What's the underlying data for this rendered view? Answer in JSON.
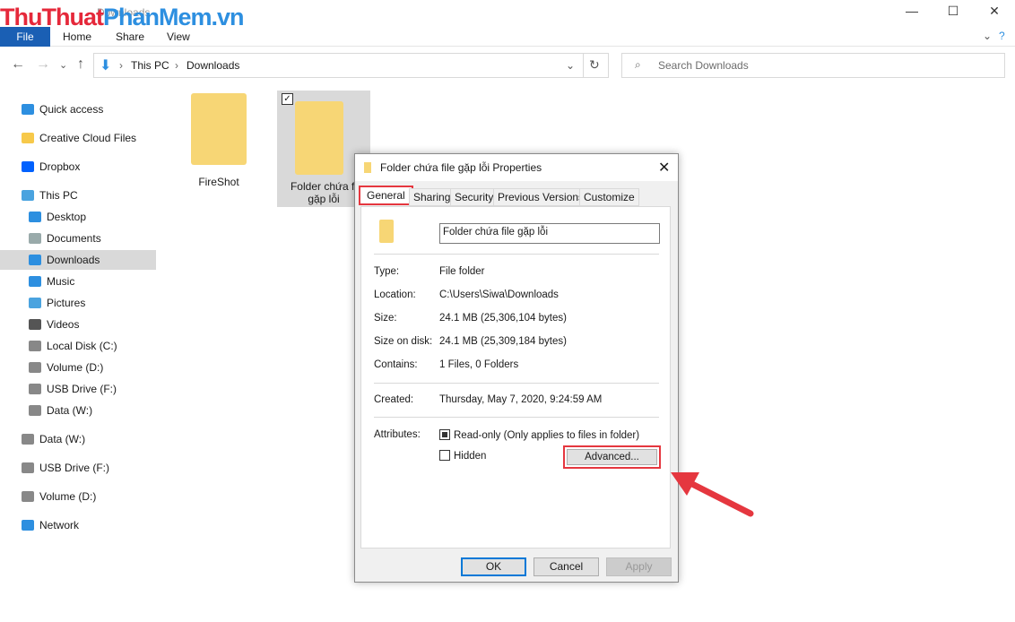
{
  "window": {
    "title": "Downloads",
    "logo": "ThuThuatPhanMem.vn",
    "logo_a": "ThuThuat",
    "logo_b": "PhanMem.vn"
  },
  "ribbon": {
    "tabs": [
      "File",
      "Home",
      "Share",
      "View"
    ]
  },
  "address": {
    "path": [
      "This PC",
      "Downloads"
    ]
  },
  "search": {
    "placeholder": "Search Downloads"
  },
  "sidebar": {
    "items": [
      {
        "label": "Quick access",
        "icon": "star-icon",
        "color": "#2d8fe0"
      },
      {
        "label": "Creative Cloud Files",
        "icon": "creative-cloud-icon",
        "color": "#f7c94a"
      },
      {
        "label": "Dropbox",
        "icon": "dropbox-icon",
        "color": "#0061fe"
      },
      {
        "label": "This PC",
        "icon": "computer-icon",
        "color": "#4aa3df"
      },
      {
        "label": "Desktop",
        "icon": "desktop-icon",
        "color": "#2d8fe0"
      },
      {
        "label": "Documents",
        "icon": "documents-icon",
        "color": "#9aa"
      },
      {
        "label": "Downloads",
        "icon": "downloads-icon",
        "color": "#2d8fe0",
        "selected": true
      },
      {
        "label": "Music",
        "icon": "music-icon",
        "color": "#2d8fe0"
      },
      {
        "label": "Pictures",
        "icon": "pictures-icon",
        "color": "#4aa3df"
      },
      {
        "label": "Videos",
        "icon": "videos-icon",
        "color": "#555"
      },
      {
        "label": "Local Disk (C:)",
        "icon": "disk-icon",
        "color": "#888"
      },
      {
        "label": "Volume (D:)",
        "icon": "disk-icon",
        "color": "#888"
      },
      {
        "label": "USB Drive (F:)",
        "icon": "usb-icon",
        "color": "#888"
      },
      {
        "label": "Data (W:)",
        "icon": "disk-icon",
        "color": "#888"
      },
      {
        "label": "Data (W:)",
        "icon": "disk-icon",
        "color": "#888"
      },
      {
        "label": "USB Drive (F:)",
        "icon": "usb-icon",
        "color": "#888"
      },
      {
        "label": "Volume (D:)",
        "icon": "disk-icon",
        "color": "#888"
      },
      {
        "label": "Network",
        "icon": "network-icon",
        "color": "#2d8fe0"
      }
    ]
  },
  "files": [
    {
      "name": "FireShot"
    },
    {
      "name": "Folder chứa file gặp lỗi",
      "line1": "Folder chứa fi",
      "line2": "gặp lỗi",
      "selected": true
    }
  ],
  "dialog": {
    "title": "Folder chứa file gặp lỗi Properties",
    "tabs": [
      "General",
      "Sharing",
      "Security",
      "Previous Versions",
      "Customize"
    ],
    "name_value": "Folder chứa file gặp lỗi",
    "rows": [
      {
        "label": "Type:",
        "value": "File folder"
      },
      {
        "label": "Location:",
        "value": "C:\\Users\\Siwa\\Downloads"
      },
      {
        "label": "Size:",
        "value": "24.1 MB (25,306,104 bytes)"
      },
      {
        "label": "Size on disk:",
        "value": "24.1 MB (25,309,184 bytes)"
      },
      {
        "label": "Contains:",
        "value": "1 Files, 0 Folders"
      },
      {
        "label": "Created:",
        "value": "Thursday, May 7, 2020, 9:24:59 AM"
      }
    ],
    "attributes_label": "Attributes:",
    "readonly": "Read-only (Only applies to files in folder)",
    "hidden": "Hidden",
    "advanced": "Advanced...",
    "ok": "OK",
    "cancel": "Cancel",
    "apply": "Apply"
  },
  "colors": {
    "highlight": "#e5373f",
    "accent": "#1a5fb4"
  }
}
